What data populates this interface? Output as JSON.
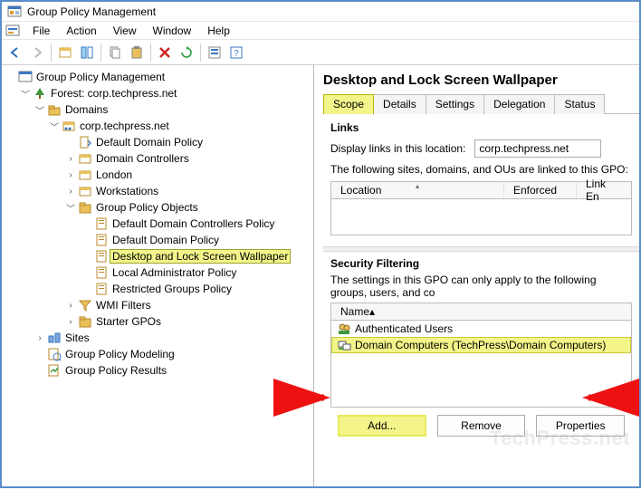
{
  "window": {
    "title": "Group Policy Management"
  },
  "menus": {
    "file": "File",
    "action": "Action",
    "view": "View",
    "window": "Window",
    "help": "Help"
  },
  "tree": {
    "root": "Group Policy Management",
    "forest": "Forest: corp.techpress.net",
    "domains": "Domains",
    "domain": "corp.techpress.net",
    "items": {
      "defaultDomainPolicy": "Default Domain Policy",
      "domainControllers": "Domain Controllers",
      "london": "London",
      "workstations": "Workstations",
      "gpoFolder": "Group Policy Objects",
      "gpos": {
        "defaultDCPolicy": "Default Domain Controllers Policy",
        "defaultDomainPolicy2": "Default Domain Policy",
        "desktopWallpaper": "Desktop and Lock Screen Wallpaper",
        "localAdmin": "Local Administrator Policy",
        "restrictedGroups": "Restricted Groups Policy"
      },
      "wmiFilters": "WMI Filters",
      "starterGPOs": "Starter GPOs"
    },
    "sites": "Sites",
    "modeling": "Group Policy Modeling",
    "results": "Group Policy Results"
  },
  "detail": {
    "title": "Desktop and Lock Screen Wallpaper",
    "tabs": {
      "scope": "Scope",
      "details": "Details",
      "settings": "Settings",
      "delegation": "Delegation",
      "status": "Status"
    },
    "links": {
      "heading": "Links",
      "displayLabel": "Display links in this location:",
      "location": "corp.techpress.net",
      "desc": "The following sites, domains, and OUs are linked to this GPO:",
      "cols": {
        "location": "Location",
        "enforced": "Enforced",
        "linkEnabled": "Link En"
      }
    },
    "security": {
      "heading": "Security Filtering",
      "desc": "The settings in this GPO can only apply to the following groups, users, and co",
      "col": "Name",
      "rows": {
        "auth": "Authenticated Users",
        "domComp": "Domain Computers (TechPress\\Domain Computers)"
      }
    },
    "buttons": {
      "add": "Add...",
      "remove": "Remove",
      "properties": "Properties"
    }
  },
  "watermark": "TechPress.net"
}
